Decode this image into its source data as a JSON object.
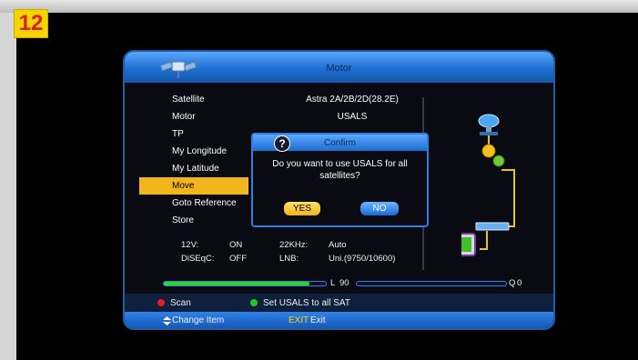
{
  "step_badge": "12",
  "header": {
    "title": "Motor",
    "icon": "satellite-dish-icon"
  },
  "menu": [
    {
      "label": "Satellite",
      "value": "Astra 2A/2B/2D(28.2E)"
    },
    {
      "label": "Motor",
      "value": "USALS"
    },
    {
      "label": "TP",
      "value": ""
    },
    {
      "label": "My Longitude",
      "value": ""
    },
    {
      "label": "My Latitude",
      "value": ""
    },
    {
      "label": "Move",
      "value": "",
      "selected": true
    },
    {
      "label": "Goto Reference",
      "value": ""
    },
    {
      "label": "Store",
      "value": ""
    }
  ],
  "info": {
    "v12_label": "12V:",
    "v12_value": "ON",
    "khz_label": "22KHz:",
    "khz_value": "Auto",
    "diseqc_label": "DiSEqC:",
    "diseqc_value": "OFF",
    "lnb_label": "LNB:",
    "lnb_value": "Uni.(9750/10600)"
  },
  "signal": {
    "level_label": "L",
    "level_value": "90",
    "level_percent": 90,
    "quality_label": "Q",
    "quality_value": "0",
    "quality_percent": 0
  },
  "footer": {
    "red_label": "Scan",
    "green_label": "Set USALS to all SAT",
    "change_item": "Change Item",
    "exit_key": "EXIT",
    "exit_label": "Exit"
  },
  "dialog": {
    "title": "Confirm",
    "message": "Do you want to use USALS for all satellites?",
    "yes_label": "YES",
    "no_label": "NO",
    "icon": "question-icon"
  },
  "diagram_icons": [
    "dish-icon",
    "motor-gears-icon",
    "receiver-icon",
    "tv-icon"
  ],
  "colors": {
    "accent_blue": "#1e6ed0",
    "highlight": "#f2b51c",
    "signal_green": "#28d828"
  }
}
